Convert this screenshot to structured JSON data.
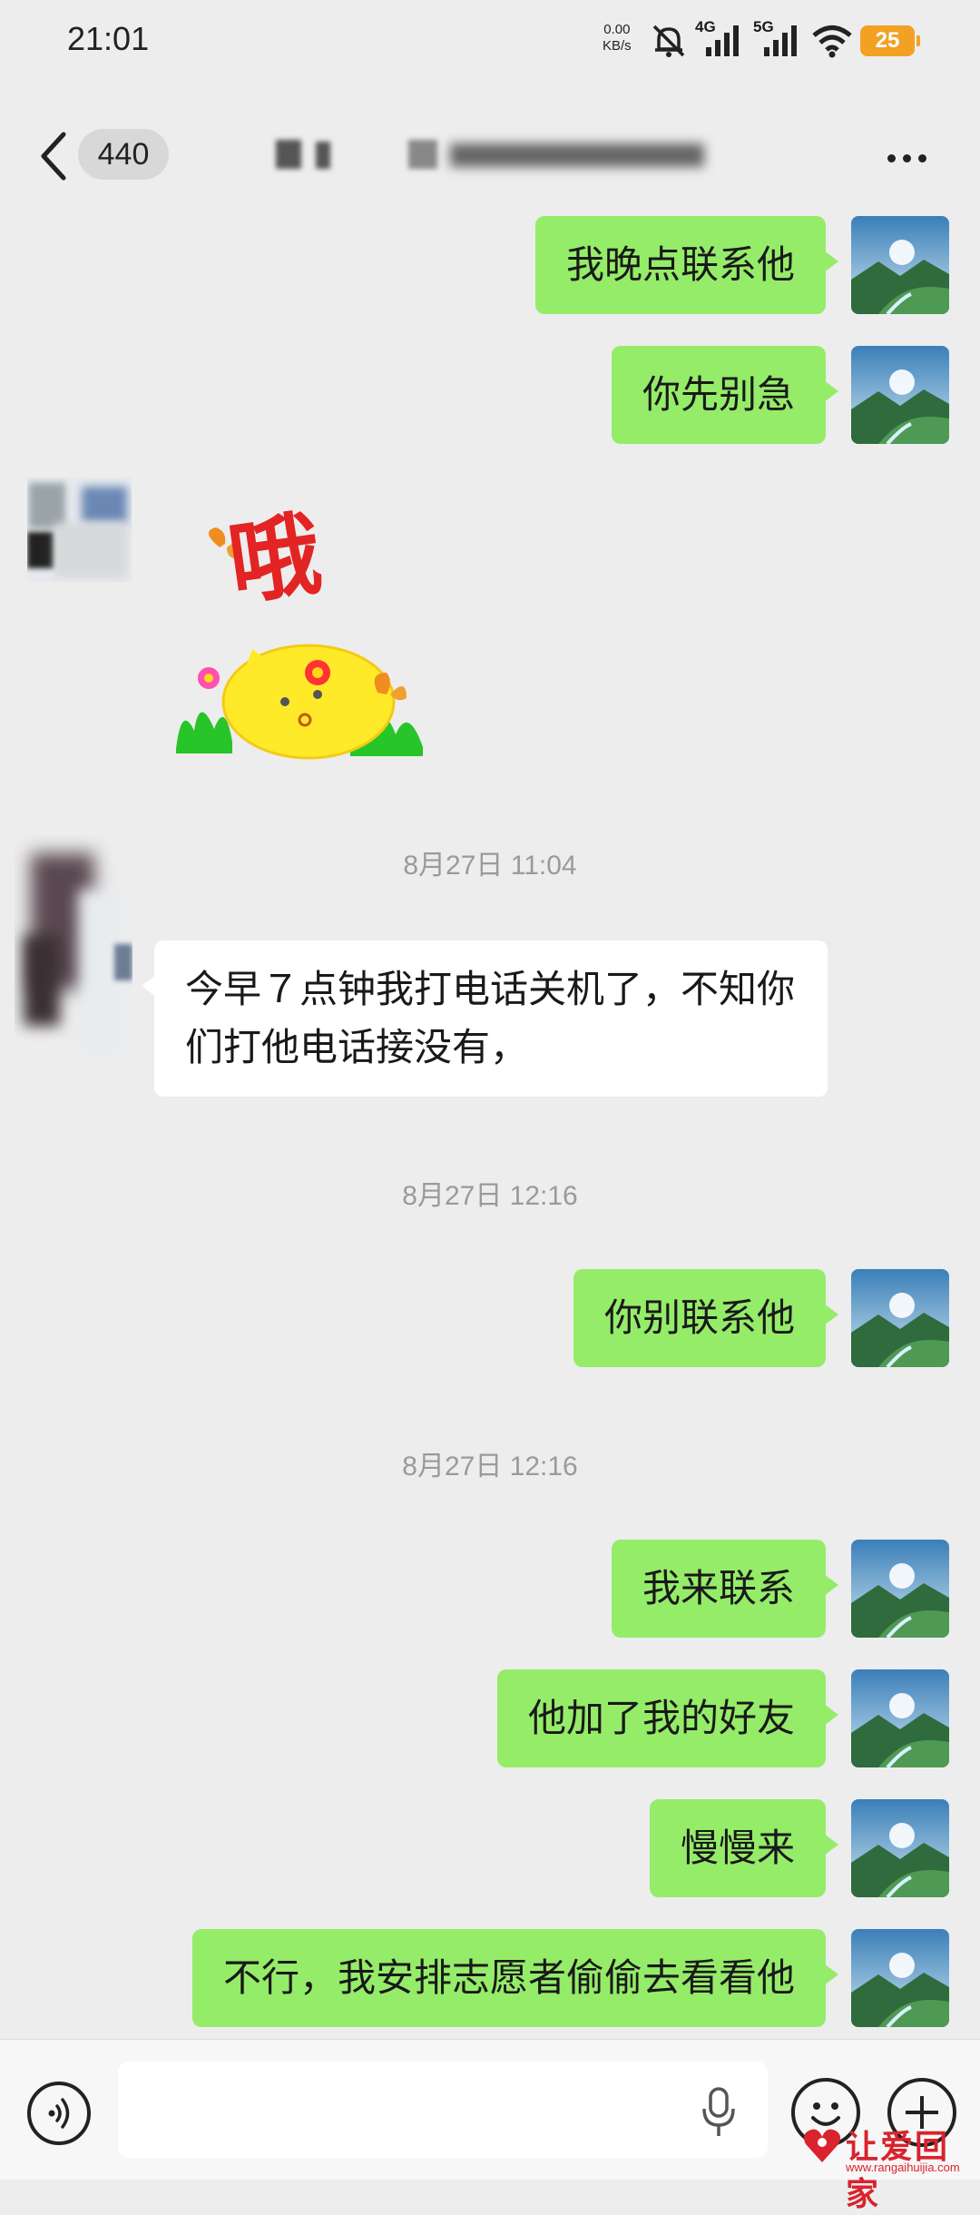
{
  "status_bar": {
    "time": "21:01",
    "net_speed_value": "0.00",
    "net_speed_unit": "KB/s",
    "signal1_label": "4G",
    "signal2_label": "5G",
    "battery": "25"
  },
  "header": {
    "unread_count": "440"
  },
  "messages": [
    {
      "side": "right",
      "text": "我晚点联系他"
    },
    {
      "side": "right",
      "text": "你先别急"
    },
    {
      "side": "left",
      "type": "sticker",
      "sticker_text": "哦"
    },
    {
      "type": "timestamp",
      "text": "8月27日 11:04"
    },
    {
      "side": "left",
      "text": "今早７点钟我打电话关机了，不知你们打他电话接没有，"
    },
    {
      "type": "timestamp",
      "text": "8月27日 12:16"
    },
    {
      "side": "right",
      "text": "你别联系他"
    },
    {
      "type": "timestamp",
      "text": "8月27日 12:16"
    },
    {
      "side": "right",
      "text": "我来联系"
    },
    {
      "side": "right",
      "text": "他加了我的好友"
    },
    {
      "side": "right",
      "text": "慢慢来"
    },
    {
      "side": "right",
      "text": "不行，我安排志愿者偷偷去看看他"
    }
  ],
  "watermark": {
    "text": "让爱回家",
    "url": "www.rangaihuijia.com"
  },
  "colors": {
    "outgoing_bubble": "#95ec69",
    "incoming_bubble": "#ffffff",
    "background": "#ededed"
  }
}
